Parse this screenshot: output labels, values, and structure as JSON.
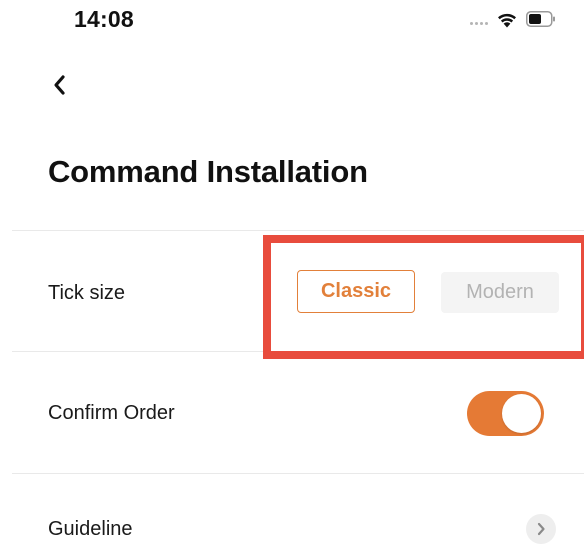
{
  "status_bar": {
    "time": "14:08",
    "icons": [
      "signal-dots-icon",
      "wifi-icon",
      "battery-icon"
    ]
  },
  "header": {
    "back_icon": "chevron-left-icon",
    "title": "Command Installation"
  },
  "settings": {
    "tick_size": {
      "label": "Tick size",
      "options": [
        "Classic",
        "Modern"
      ],
      "selected": "Classic"
    },
    "confirm_order": {
      "label": "Confirm Order",
      "enabled": true
    },
    "guideline": {
      "label": "Guideline",
      "icon": "chevron-right-icon"
    }
  },
  "colors": {
    "accent": "#e57a35",
    "highlight_box": "#e84c3d",
    "inactive_segment_bg": "#f4f4f4",
    "inactive_segment_text": "#b3b3b3",
    "divider": "#e9e9e9"
  }
}
